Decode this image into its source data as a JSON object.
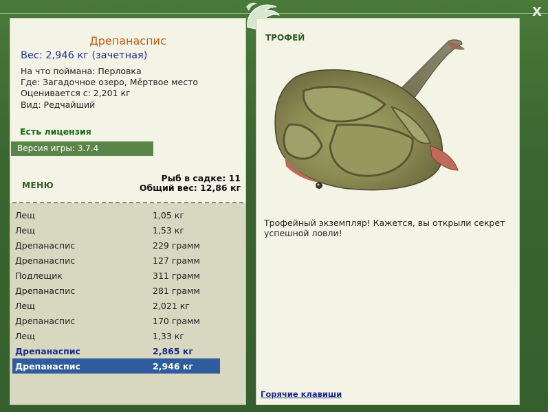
{
  "window": {
    "close_label": "X"
  },
  "catch": {
    "name": "Дрепанаспис",
    "weight": "Вес: 2,946 кг (зачетная)",
    "bait": "На что поймана: Перловка",
    "location": "Где: Загадочное озеро, Мёртвое место",
    "value": "Оценивается с: 2,201 кг",
    "rarity": "Вид: Редчайший"
  },
  "license": "Есть лицензия",
  "version": "Версия игры: 3.7.4",
  "menu_label": "МЕНЮ",
  "keepnet": {
    "count_label": "Рыб в садке: 11",
    "total_label": "Общий вес: 12,86 кг"
  },
  "fish_list": [
    {
      "name": "Лещ",
      "weight": "1,05 кг",
      "style": "normal"
    },
    {
      "name": "Лещ",
      "weight": "1,53 кг",
      "style": "normal"
    },
    {
      "name": "Дрепанаспис",
      "weight": "229 грамм",
      "style": "normal"
    },
    {
      "name": "Дрепанаспис",
      "weight": "127 грамм",
      "style": "normal"
    },
    {
      "name": "Подлещик",
      "weight": "311 грамм",
      "style": "normal"
    },
    {
      "name": "Дрепанаспис",
      "weight": "281 грамм",
      "style": "normal"
    },
    {
      "name": "Лещ",
      "weight": "2,021 кг",
      "style": "normal"
    },
    {
      "name": "Дрепанаспис",
      "weight": "170 грамм",
      "style": "normal"
    },
    {
      "name": "Лещ",
      "weight": "1,33 кг",
      "style": "normal"
    },
    {
      "name": "Дрепанаспис",
      "weight": "2,865 кг",
      "style": "bold"
    },
    {
      "name": "Дрепанаспис",
      "weight": "2,946 кг",
      "style": "selected"
    }
  ],
  "trophy": {
    "label": "ТРОФЕЙ",
    "text": "Трофейный экземпляр! Кажется, вы открыли секрет успешной ловли!"
  },
  "hotkeys_label": "Горячие клавиши",
  "colors": {
    "frame": "#3f6b33",
    "panel": "#f4f4e6",
    "name_orange": "#c45c1c",
    "weight_blue": "#1f2e96",
    "selected_row": "#2f5c9c",
    "license_green": "#176a17"
  },
  "icons": {
    "logo": "fish-logo-icon",
    "close": "close-icon"
  }
}
